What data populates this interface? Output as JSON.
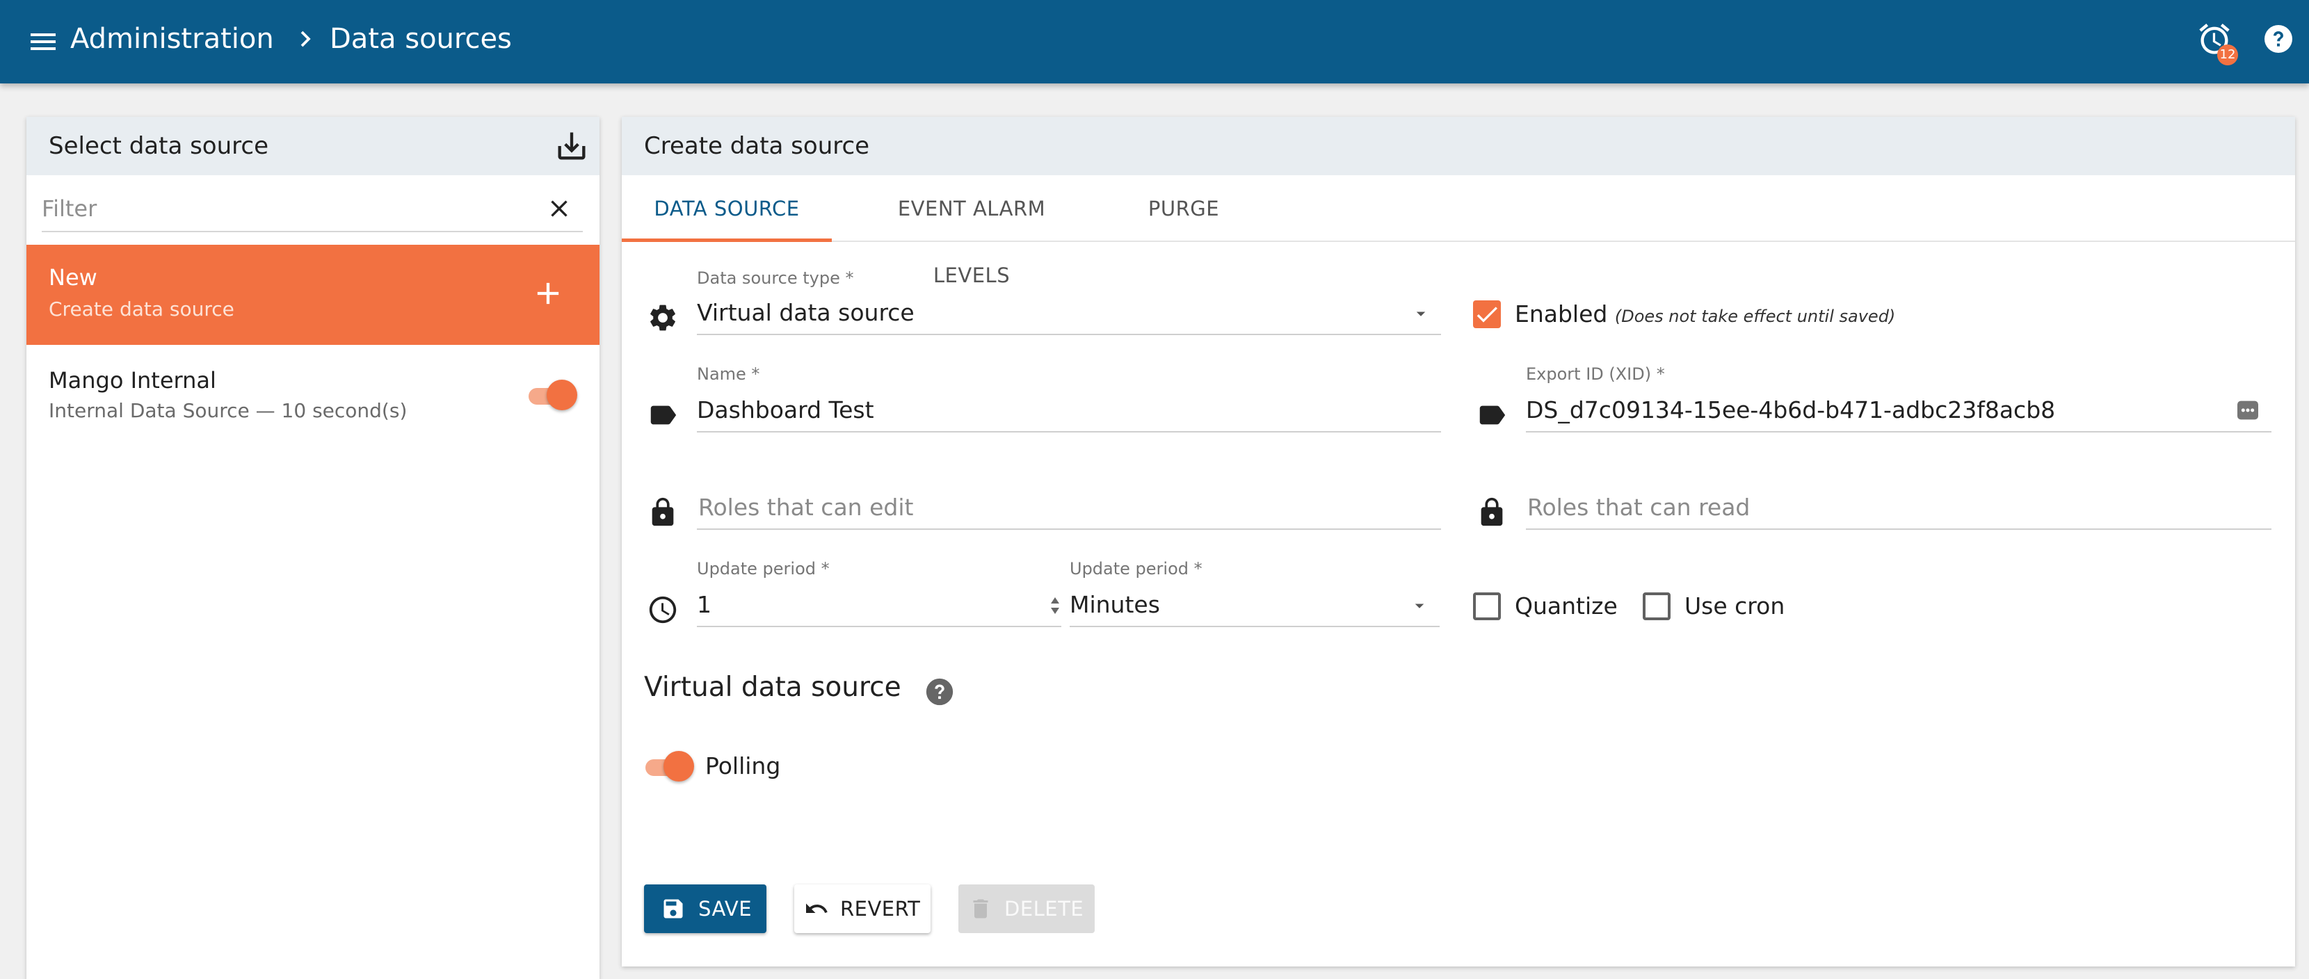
{
  "topbar": {
    "breadcrumb": [
      "Administration",
      "Data sources"
    ],
    "alarm_count": "12",
    "icons": [
      "menu-icon",
      "chevron-right-icon",
      "alarm-clock-icon",
      "help-icon"
    ]
  },
  "left_panel": {
    "title": "Select data source",
    "filter_placeholder": "Filter",
    "new_item": {
      "title": "New",
      "subtitle": "Create data source"
    },
    "items": [
      {
        "name": "Mango Internal",
        "description": "Internal Data Source — 10 second(s)",
        "enabled": true
      }
    ]
  },
  "editor": {
    "title": "Create data source",
    "tabs": [
      "DATA SOURCE",
      "EVENT ALARM LEVELS",
      "PURGE"
    ],
    "active_tab": "DATA SOURCE",
    "type_field": {
      "label": "Data source type *",
      "value": "Virtual data source"
    },
    "enabled": {
      "label": "Enabled",
      "note": "(Does not take effect until saved)",
      "checked": true
    },
    "name_field": {
      "label": "Name *",
      "value": "Dashboard Test"
    },
    "xid_field": {
      "label": "Export ID (XID) *",
      "value": "DS_d7c09134-15ee-4b6d-b471-adbc23f8acb8"
    },
    "edit_roles": {
      "placeholder": "Roles that can edit"
    },
    "read_roles": {
      "placeholder": "Roles that can read"
    },
    "update_period": {
      "label": "Update period *",
      "value": "1"
    },
    "update_unit": {
      "label": "Update period *",
      "value": "Minutes"
    },
    "quantize": {
      "label": "Quantize",
      "checked": false
    },
    "use_cron": {
      "label": "Use cron",
      "checked": false
    },
    "section_title": "Virtual data source",
    "polling": {
      "label": "Polling",
      "on": true
    },
    "buttons": {
      "save": "SAVE",
      "revert": "REVERT",
      "delete": "DELETE"
    }
  },
  "colors": {
    "primary": "#0b5b8a",
    "accent": "#f27141",
    "header_bg": "#e8edf1"
  }
}
